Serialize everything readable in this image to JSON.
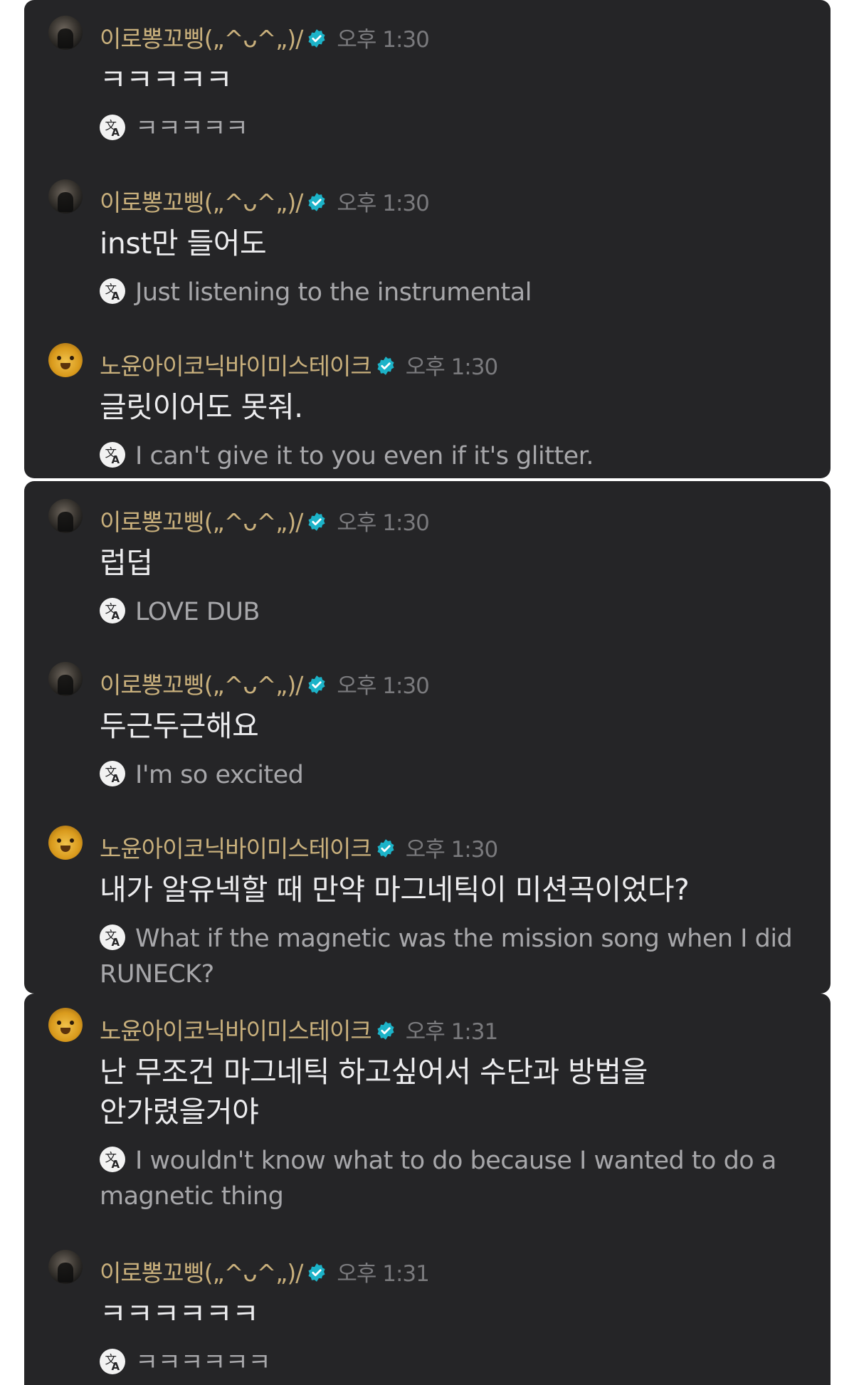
{
  "messages": [
    {
      "user": "이로뽕꼬삥(„^ᴗ^„)/",
      "time": "오후 1:30",
      "text": "ㅋㅋㅋㅋㅋ",
      "translation": "ㅋㅋㅋㅋㅋ"
    },
    {
      "user": "이로뽕꼬삥(„^ᴗ^„)/",
      "time": "오후 1:30",
      "text": "inst만 들어도",
      "translation": "Just listening to the instrumental"
    },
    {
      "user": "노윤아이코닉바이미스테이크",
      "time": "오후 1:30",
      "text": "글릿이어도 못줘.",
      "translation": "I can't give it to you even if it's glitter."
    },
    {
      "user": "이로뽕꼬삥(„^ᴗ^„)/",
      "time": "오후 1:30",
      "text": "럽덥",
      "translation": "LOVE DUB"
    },
    {
      "user": "이로뽕꼬삥(„^ᴗ^„)/",
      "time": "오후 1:30",
      "text": "두근두근해요",
      "translation": "I'm so excited"
    },
    {
      "user": "노윤아이코닉바이미스테이크",
      "time": "오후 1:30",
      "text": "내가 알유넥할 때 만약 마그네틱이 미션곡이었다?",
      "translation": "What if the magnetic was the mission song when I did RUNECK?"
    },
    {
      "user": "노윤아이코닉바이미스테이크",
      "time": "오후 1:31",
      "text": "난 무조건 마그네틱 하고싶어서 수단과 방법을 안가렸을거야",
      "translation": "I wouldn't know what to do because I wanted to do a magnetic thing"
    },
    {
      "user": "이로뽕꼬삥(„^ᴗ^„)/",
      "time": "오후 1:31",
      "text": "ㅋㅋㅋㅋㅋㅋ",
      "translation": "ㅋㅋㅋㅋㅋㅋ"
    }
  ],
  "colors": {
    "background": "#252527",
    "username": "#c9b07c",
    "verified": "#1cb3c8",
    "timestamp": "#7a7a7d",
    "text": "#ececee",
    "translation": "#a7a7aa"
  },
  "icons": {
    "verified": "verified-badge-icon",
    "translate": "translate-icon"
  }
}
